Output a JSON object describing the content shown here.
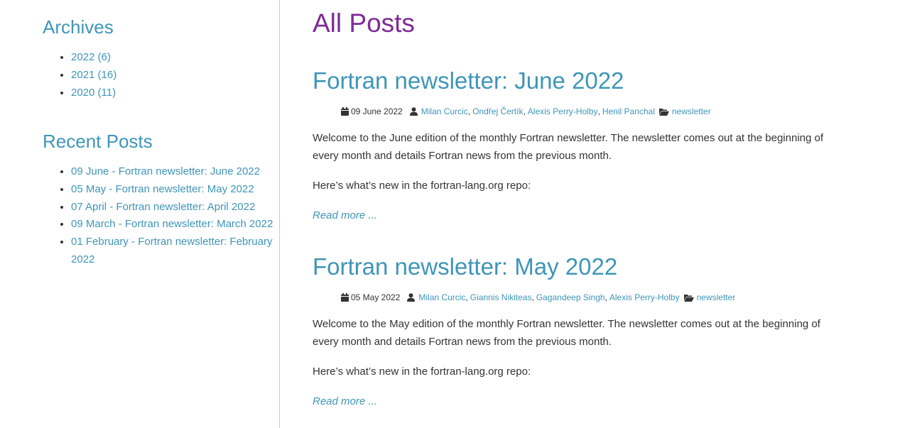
{
  "sidebar": {
    "archives_heading": "Archives",
    "archives": [
      {
        "label": "2022 (6)"
      },
      {
        "label": "2021 (16)"
      },
      {
        "label": "2020 (11)"
      }
    ],
    "recent_heading": "Recent Posts",
    "recent": [
      {
        "label": "09 June - Fortran newsletter: June 2022"
      },
      {
        "label": "05 May - Fortran newsletter: May 2022"
      },
      {
        "label": "07 April - Fortran newsletter: April 2022"
      },
      {
        "label": "09 March - Fortran newsletter: March 2022"
      },
      {
        "label": "01 February - Fortran newsletter: February 2022"
      }
    ]
  },
  "main": {
    "title": "All Posts",
    "posts": [
      {
        "title": "Fortran newsletter: June 2022",
        "date": "09 June 2022",
        "authors": [
          "Milan Curcic",
          "Ondřej Čertík",
          "Alexis Perry-Holby",
          "Henil Panchal"
        ],
        "category": "newsletter",
        "paragraph1": "Welcome to the June edition of the monthly Fortran newsletter. The newsletter comes out at the beginning of every month and details Fortran news from the previous month.",
        "paragraph2": "Here’s what’s new in the fortran-lang.org repo:",
        "read_more": "Read more ..."
      },
      {
        "title": "Fortran newsletter: May 2022",
        "date": "05 May 2022",
        "authors": [
          "Milan Curcic",
          "Giannis Nikiteas",
          "Gagandeep Singh",
          "Alexis Perry-Holby"
        ],
        "category": "newsletter",
        "paragraph1": "Welcome to the May edition of the monthly Fortran newsletter. The newsletter comes out at the beginning of every month and details Fortran news from the previous month.",
        "paragraph2": "Here’s what’s new in the fortran-lang.org repo:",
        "read_more": "Read more ..."
      }
    ]
  },
  "colors": {
    "link": "#3e95b8",
    "page_title": "#7f2a96",
    "text": "#333333",
    "divider": "#cccccc"
  },
  "icons": {
    "date": "calendar-icon",
    "author": "user-icon",
    "category": "folder-open-icon"
  }
}
